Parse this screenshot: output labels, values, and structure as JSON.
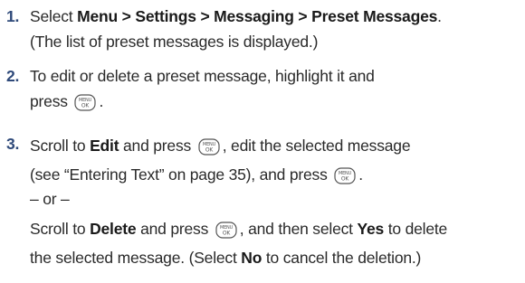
{
  "steps": [
    {
      "num": "1.",
      "l1_pre": "Select ",
      "l1_bold": "Menu > Settings > Messaging > Preset Messages",
      "l1_post": ".",
      "l2": "(The list of preset messages is displayed.)"
    },
    {
      "num": "2.",
      "l1": "To edit or delete a preset message, highlight it and",
      "l2_pre": "press ",
      "l2_post": "."
    },
    {
      "num": "3.",
      "l1_pre": "Scroll to ",
      "l1_bold": "Edit",
      "l1_mid": " and press ",
      "l1_post": ", edit the selected message",
      "l2_pre": "(see “Entering Text” on page 35), and press ",
      "l2_post": ".",
      "or": "– or –",
      "l4_pre": "Scroll to ",
      "l4_bold": "Delete",
      "l4_mid": " and press ",
      "l4_post": ", and then select ",
      "l4_bold2": "Yes",
      "l4_end": " to delete",
      "l5_pre": "the selected message. (Select ",
      "l5_bold": "No",
      "l5_post": " to cancel the deletion.)"
    }
  ],
  "key_icon": {
    "name": "menu-ok-key-icon",
    "top_text": "MENU",
    "bottom_text": "OK",
    "color": "#555555"
  }
}
